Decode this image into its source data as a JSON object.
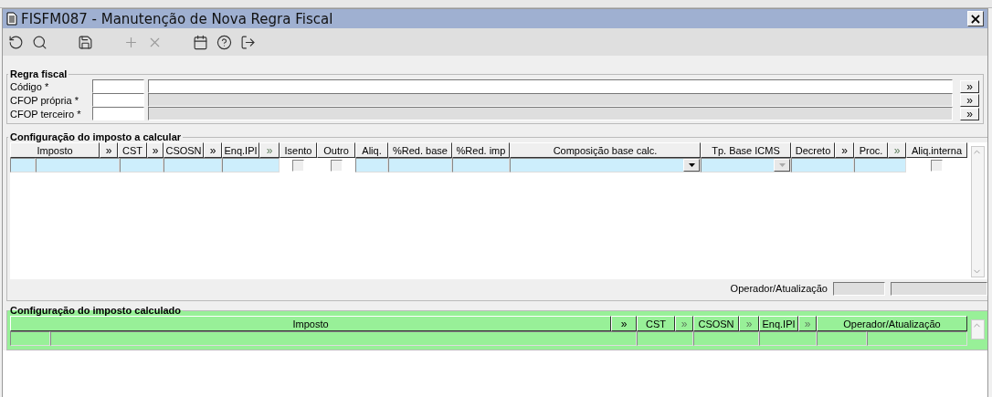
{
  "window": {
    "title": "FISFM087 - Manutenção de Nova Regra Fiscal",
    "close": "×"
  },
  "toolbar": [
    {
      "kind": "undo",
      "disabled": false
    },
    {
      "kind": "search",
      "disabled": false
    },
    {
      "kind": "save",
      "disabled": false
    },
    {
      "kind": "add",
      "disabled": true
    },
    {
      "kind": "delete",
      "disabled": true
    },
    {
      "kind": "calendar",
      "disabled": false
    },
    {
      "kind": "help",
      "disabled": false
    },
    {
      "kind": "exit",
      "disabled": false
    }
  ],
  "regra_fiscal": {
    "title": "Regra fiscal",
    "fields": [
      {
        "label": "Código *",
        "disabled": false,
        "lookup": "»"
      },
      {
        "label": "CFOP própria *",
        "disabled": true,
        "lookup": "»"
      },
      {
        "label": "CFOP terceiro *",
        "disabled": true,
        "lookup": "»"
      }
    ]
  },
  "imposto_a_calcular": {
    "title": "Configuração do imposto a calcular",
    "columns": [
      {
        "label": "Imposto",
        "kind": "head"
      },
      {
        "label": "»",
        "kind": "button",
        "disabled": false
      },
      {
        "label": "CST",
        "kind": "head"
      },
      {
        "label": "»",
        "kind": "button",
        "disabled": false
      },
      {
        "label": "CSOSN",
        "kind": "head"
      },
      {
        "label": "»",
        "kind": "button",
        "disabled": false
      },
      {
        "label": "Enq.IPI",
        "kind": "head"
      },
      {
        "label": "»",
        "kind": "button",
        "disabled": true
      },
      {
        "label": "Isento",
        "kind": "head"
      },
      {
        "label": "Outro",
        "kind": "head"
      },
      {
        "label": "Aliq.",
        "kind": "head"
      },
      {
        "label": "%Red. base",
        "kind": "head"
      },
      {
        "label": "%Red. imp",
        "kind": "head"
      },
      {
        "label": "Composição base calc.",
        "kind": "head"
      },
      {
        "label": "Tp. Base ICMS",
        "kind": "head"
      },
      {
        "label": "Decreto",
        "kind": "head"
      },
      {
        "label": "»",
        "kind": "button",
        "disabled": false
      },
      {
        "label": "Proc.",
        "kind": "head"
      },
      {
        "label": "»",
        "kind": "button",
        "disabled": true
      },
      {
        "label": "Aliq.interna",
        "kind": "head"
      }
    ],
    "row": [
      {
        "kind": "text"
      },
      {
        "kind": "text"
      },
      {
        "kind": "text"
      },
      {
        "kind": "text"
      },
      {
        "kind": "text"
      },
      {
        "kind": "check",
        "checked": false
      },
      {
        "kind": "check",
        "checked": false
      },
      {
        "kind": "text"
      },
      {
        "kind": "text"
      },
      {
        "kind": "text"
      },
      {
        "kind": "select",
        "disabled": false
      },
      {
        "kind": "select",
        "disabled": true
      },
      {
        "kind": "text"
      },
      {
        "kind": "text"
      },
      {
        "kind": "check",
        "checked": false
      }
    ],
    "operador_label": "Operador/Atualização"
  },
  "imposto_calculado": {
    "title": "Configuração do imposto calculado",
    "columns": [
      {
        "label": "Imposto",
        "kind": "head"
      },
      {
        "label": "»",
        "kind": "button",
        "disabled": false
      },
      {
        "label": "CST",
        "kind": "head"
      },
      {
        "label": "»",
        "kind": "button",
        "disabled": true
      },
      {
        "label": "CSOSN",
        "kind": "head"
      },
      {
        "label": "»",
        "kind": "button",
        "disabled": true
      },
      {
        "label": "Enq.IPI",
        "kind": "head"
      },
      {
        "label": "»",
        "kind": "button",
        "disabled": true
      },
      {
        "label": "Operador/Atualização",
        "kind": "head"
      }
    ],
    "row": [
      {
        "kind": "text"
      },
      {
        "kind": "text"
      },
      {
        "kind": "text"
      },
      {
        "kind": "text"
      },
      {
        "kind": "text"
      },
      {
        "kind": "text"
      },
      {
        "kind": "text"
      }
    ]
  }
}
